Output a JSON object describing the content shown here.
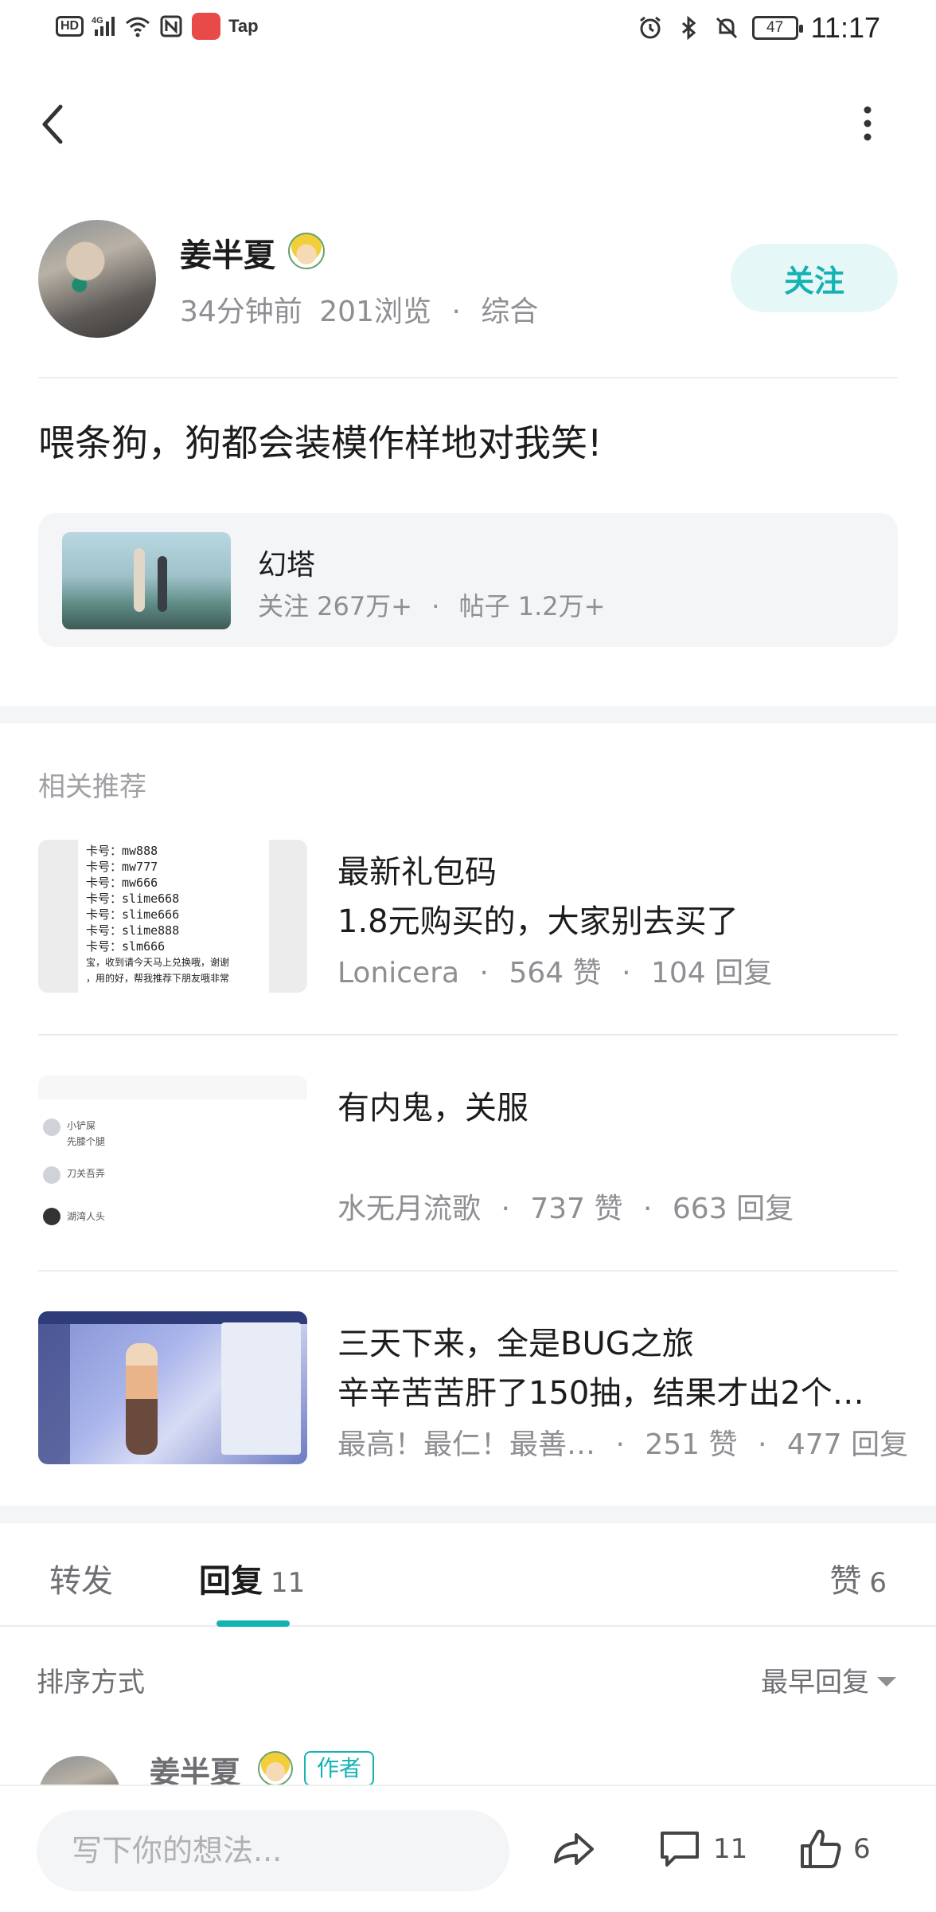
{
  "status_bar": {
    "hd": "HD",
    "network": "4G",
    "app_label": "Tap",
    "battery": "47",
    "time": "11:17"
  },
  "post": {
    "author": "姜半夏",
    "time_ago": "34分钟前",
    "views": "201浏览",
    "category": "综合",
    "follow_label": "关注",
    "title": "喂条狗，狗都会装模作样地对我笑!"
  },
  "game_card": {
    "name": "幻塔",
    "followers": "关注 267万+",
    "posts": "帖子 1.2万+"
  },
  "related": {
    "title": "相关推荐",
    "items": [
      {
        "title_line1": "最新礼包码",
        "title_line2": "1.8元购买的，大家别去买了",
        "author": "Lonicera",
        "likes": "564 赞",
        "replies": "104 回复",
        "thumb_lines": [
          "卡号：mw888",
          "卡号：mw777",
          "卡号：mw666",
          "卡号：slime668",
          "卡号：slime666",
          "卡号：slime888",
          "卡号：slm666",
          "宝，收到请今天马上兑换哦，谢谢",
          "，用的好，帮我推荐下朋友哦非常"
        ]
      },
      {
        "title_line1": "有内鬼，关服",
        "title_line2": "",
        "author": "水无月流歌",
        "likes": "737 赞",
        "replies": "663 回复",
        "thumb_lines": [
          "小铲屎",
          "先膝个腿",
          "刀关吾弄",
          "湖湾人头"
        ]
      },
      {
        "title_line1": "三天下来，全是BUG之旅",
        "title_line2": "辛辛苦苦肝了150抽，结果才出2个…",
        "author": "最高！最仁！最善…",
        "likes": "251 赞",
        "replies": "477 回复",
        "thumb_lines": []
      }
    ]
  },
  "tabs": {
    "forward": "转发",
    "reply": "回复",
    "reply_count": "11",
    "like": "赞",
    "like_count": "6"
  },
  "sort": {
    "label": "排序方式",
    "value": "最早回复"
  },
  "first_reply": {
    "author": "姜半夏",
    "badge": "作者"
  },
  "bottom_bar": {
    "placeholder": "写下你的想法...",
    "comment_count": "11",
    "like_count": "6"
  },
  "colors": {
    "accent": "#15b2b4",
    "follow_bg": "#e6f7f7",
    "card_bg": "#f4f5f6",
    "muted_text": "#8e8e93"
  }
}
